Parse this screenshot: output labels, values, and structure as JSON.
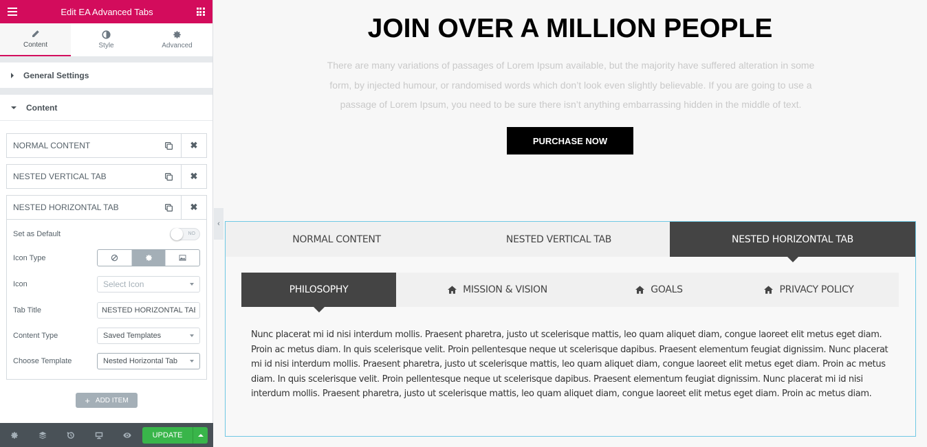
{
  "panel": {
    "title": "Edit EA Advanced Tabs",
    "tabs": [
      {
        "label": "Content",
        "icon": "pencil-icon",
        "active": true
      },
      {
        "label": "Style",
        "icon": "half-circle-icon",
        "active": false
      },
      {
        "label": "Advanced",
        "icon": "gear-icon",
        "active": false
      }
    ],
    "sections": {
      "general": "General Settings",
      "content": "Content"
    },
    "repeater": [
      {
        "title": "NORMAL CONTENT"
      },
      {
        "title": "NESTED VERTICAL TAB"
      },
      {
        "title": "NESTED HORIZONTAL TAB"
      }
    ],
    "expanded": {
      "set_default_label": "Set as Default",
      "set_default_value": "NO",
      "icon_type_label": "Icon Type",
      "icon_type_options": [
        "none-icon",
        "icon-gear",
        "image-icon"
      ],
      "icon_type_selected": 1,
      "icon_label": "Icon",
      "icon_placeholder": "Select Icon",
      "tab_title_label": "Tab Title",
      "tab_title_value": "NESTED HORIZONTAL TAB",
      "content_type_label": "Content Type",
      "content_type_value": "Saved Templates",
      "choose_template_label": "Choose Template",
      "choose_template_value": "Nested Horizontal Tab"
    },
    "add_item": "ADD ITEM",
    "footer": {
      "icons": [
        "settings-icon",
        "layers-icon",
        "history-icon",
        "responsive-icon",
        "preview-icon"
      ],
      "update": "UPDATE"
    }
  },
  "preview": {
    "title": "JOIN OVER A MILLION PEOPLE",
    "text": "There are many variations of passages of Lorem Ipsum available, but the majority have suffered alteration in some form, by injected humour, or randomised words which don’t look even slightly believable. If you are going to use a passage of Lorem Ipsum, you need to be sure there isn’t anything embarrassing hidden in the middle of text.",
    "button": "PURCHASE NOW",
    "outer_tabs": [
      {
        "label": "NORMAL CONTENT",
        "active": false
      },
      {
        "label": "NESTED VERTICAL TAB",
        "active": false
      },
      {
        "label": "NESTED HORIZONTAL TAB",
        "active": true
      }
    ],
    "inner_tabs": [
      {
        "label": "PHILOSOPHY",
        "icon": null,
        "active": true
      },
      {
        "label": "MISSION & VISION",
        "icon": "home-icon",
        "active": false
      },
      {
        "label": "GOALS",
        "icon": "home-icon",
        "active": false
      },
      {
        "label": "PRIVACY POLICY",
        "icon": "home-icon",
        "active": false
      }
    ],
    "content": "Nunc placerat mi id nisi interdum mollis. Praesent pharetra, justo ut scelerisque mattis, leo quam aliquet diam, congue laoreet elit metus eget diam. Proin ac metus diam. In quis scelerisque velit. Proin pellentesque neque ut scelerisque dapibus. Praesent elementum feugiat dignissim. Nunc placerat mi id nisi interdum mollis. Praesent pharetra, justo ut scelerisque mattis, leo quam aliquet diam, congue laoreet elit metus eget diam. Proin ac metus diam. In quis scelerisque velit. Proin pellentesque neque ut scelerisque dapibus. Praesent elementum feugiat dignissim. Nunc placerat mi id nisi interdum mollis. Praesent pharetra, justo ut scelerisque mattis, leo quam aliquet diam, congue laoreet elit metus eget diam. Proin ac metus diam."
  },
  "colors": {
    "brand": "#d30c5c",
    "update": "#39b54a",
    "active_tab": "#444444",
    "selection_border": "#6ec8e4"
  }
}
